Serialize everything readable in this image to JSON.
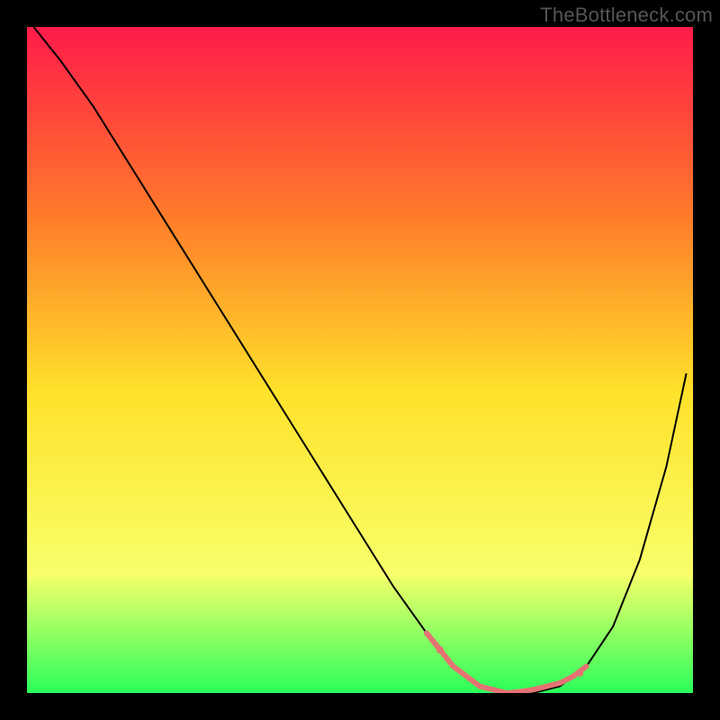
{
  "watermark": "TheBottleneck.com",
  "chart_data": {
    "type": "line",
    "title": "",
    "xlabel": "",
    "ylabel": "",
    "xlim": [
      0,
      100
    ],
    "ylim": [
      0,
      100
    ],
    "grid": false,
    "legend": false,
    "gradient_colors": {
      "top": "#ff1a4a",
      "mid_upper": "#ff7a2a",
      "mid": "#ffe22a",
      "lower": "#f8ff6a",
      "bottom": "#2aff5a"
    },
    "series": [
      {
        "name": "curve",
        "type": "line",
        "color": "#000000",
        "x": [
          1,
          5,
          10,
          15,
          20,
          25,
          30,
          35,
          40,
          45,
          50,
          55,
          60,
          64,
          68,
          72,
          76,
          80,
          84,
          88,
          92,
          96,
          99
        ],
        "y": [
          100,
          95,
          88,
          80,
          72,
          64,
          56,
          48,
          40,
          32,
          24,
          16,
          9,
          4,
          1,
          0,
          0,
          1,
          4,
          10,
          20,
          34,
          48
        ]
      },
      {
        "name": "trough-highlight",
        "type": "line",
        "color": "#e57373",
        "stroke_width": 6,
        "x": [
          60,
          62,
          64,
          66,
          68,
          70,
          72,
          74,
          76,
          78,
          80,
          82,
          84
        ],
        "y": [
          9,
          6.5,
          4,
          2.5,
          1,
          0.5,
          0,
          0.2,
          0.5,
          1,
          1.5,
          2.5,
          4
        ]
      }
    ],
    "markers": [
      {
        "name": "trough-start-marker",
        "x": 62,
        "y": 6.5,
        "color": "#e57373",
        "r": 4
      },
      {
        "name": "trough-end-marker",
        "x": 83,
        "y": 3,
        "color": "#e57373",
        "r": 4
      }
    ]
  }
}
